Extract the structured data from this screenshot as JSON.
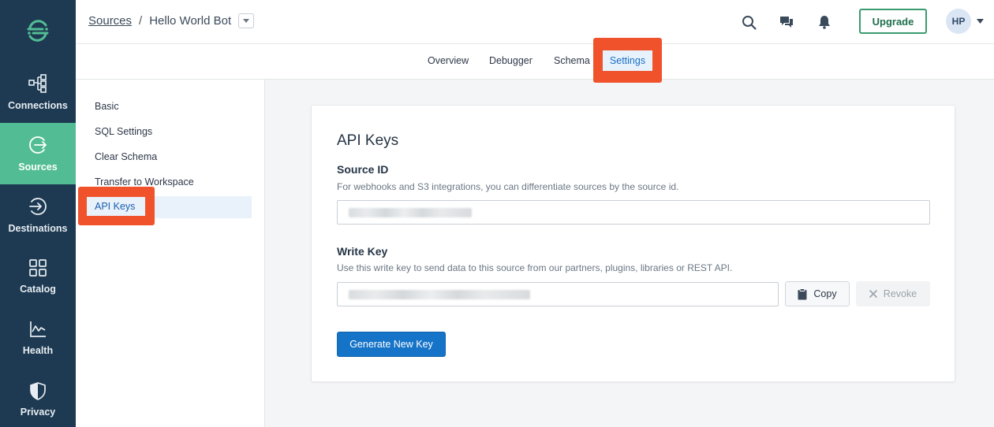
{
  "nav": {
    "items": [
      {
        "label": "Connections",
        "icon": "connections-icon"
      },
      {
        "label": "Sources",
        "icon": "sources-icon"
      },
      {
        "label": "Destinations",
        "icon": "destinations-icon"
      },
      {
        "label": "Catalog",
        "icon": "catalog-icon"
      },
      {
        "label": "Health",
        "icon": "health-icon"
      },
      {
        "label": "Privacy",
        "icon": "privacy-icon"
      }
    ],
    "active": "Sources",
    "colors": {
      "background": "#1e3a52",
      "active": "#52bd94"
    }
  },
  "header": {
    "breadcrumb_root": "Sources",
    "breadcrumb_separator": "/",
    "breadcrumb_current": "Hello World Bot",
    "upgrade_label": "Upgrade",
    "avatar_initials": "HP"
  },
  "tabs": [
    {
      "label": "Overview"
    },
    {
      "label": "Debugger"
    },
    {
      "label": "Schema"
    },
    {
      "label": "Settings",
      "active": true
    }
  ],
  "settings_nav": {
    "items": [
      {
        "label": "Basic"
      },
      {
        "label": "SQL Settings"
      },
      {
        "label": "Clear Schema"
      },
      {
        "label": "Transfer to Workspace"
      },
      {
        "label": "API Keys",
        "active": true
      }
    ]
  },
  "card": {
    "title": "API Keys",
    "source_id": {
      "label": "Source ID",
      "description": "For webhooks and S3 integrations, you can differentiate sources by the source id."
    },
    "write_key": {
      "label": "Write Key",
      "description": "Use this write key to send data to this source from our partners, plugins, libraries or REST API.",
      "copy_label": "Copy",
      "revoke_label": "Revoke"
    },
    "generate_label": "Generate New Key"
  },
  "highlight_color": "#f0532c"
}
